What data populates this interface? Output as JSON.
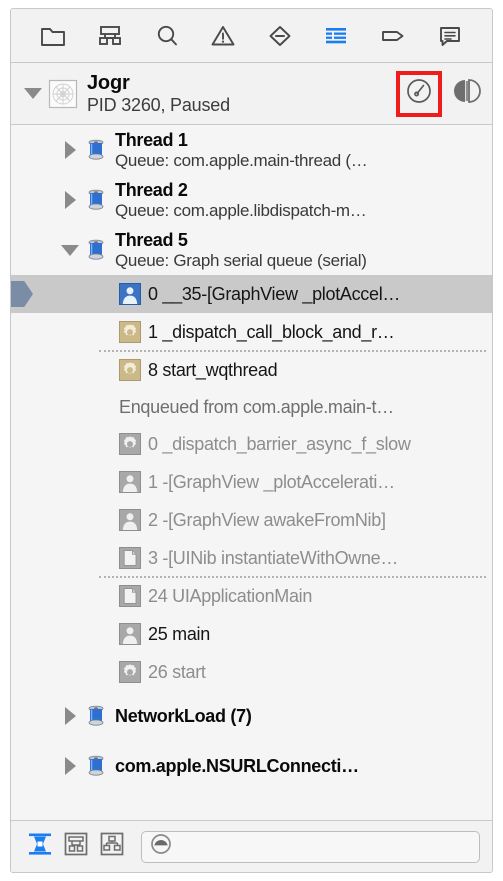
{
  "window": {
    "title": "Debug Navigator"
  },
  "colors": {
    "accent_blue": "#1a7df0",
    "icon_gray": "#4a4a4a",
    "highlight_red": "#ef1c1c",
    "selected_row": "#c9c9c9",
    "pc_marker": "#7a8ca6",
    "panel_bg": "#f5f5f5",
    "toolbar_bg": "#f2f2f2"
  },
  "top_toolbar": {
    "buttons": [
      {
        "icon": "folder-icon",
        "label": "Show the Project navigator",
        "active": false
      },
      {
        "icon": "hierarchy-icon",
        "label": "Show the Symbol navigator",
        "active": false
      },
      {
        "icon": "search-icon",
        "label": "Show the Find navigator",
        "active": false
      },
      {
        "icon": "warning-triangle-icon",
        "label": "Show the Issue navigator",
        "active": false
      },
      {
        "icon": "test-diamond-icon",
        "label": "Show the Test navigator",
        "active": false
      },
      {
        "icon": "debug-list-icon",
        "label": "Show the Debug navigator",
        "active": true
      },
      {
        "icon": "tag-icon",
        "label": "Show the Breakpoint navigator",
        "active": false
      },
      {
        "icon": "speech-bubble-icon",
        "label": "Show the Report navigator",
        "active": false
      }
    ]
  },
  "process_header": {
    "disclosure": "expanded",
    "app_icon": "app-icon",
    "name": "Jogr",
    "subtitle": "PID 3260, Paused",
    "actions": [
      {
        "icon": "gauge-icon",
        "label": "Show process gauges",
        "highlighted": true
      },
      {
        "icon": "view-split-icon",
        "label": "Toggle view",
        "highlighted": false
      }
    ]
  },
  "list": {
    "rows": [
      {
        "kind": "thread",
        "disclosure": "collapsed",
        "icon": "thread-spool-icon",
        "title": "Thread 1",
        "queue": "Queue: com.apple.main-thread (…"
      },
      {
        "kind": "thread",
        "disclosure": "collapsed",
        "icon": "thread-spool-icon",
        "title": "Thread 2",
        "queue": "Queue: com.apple.libdispatch-m…"
      },
      {
        "kind": "thread",
        "disclosure": "expanded",
        "icon": "thread-spool-icon",
        "title": "Thread 5",
        "queue": "Queue: Graph serial queue (serial)"
      },
      {
        "kind": "frame",
        "icon": "user-frame-icon-blue",
        "label": "0 __35-[GraphView _plotAccel…",
        "selected": true,
        "dim": false,
        "pc_marker": true,
        "separator": false
      },
      {
        "kind": "frame",
        "icon": "gear-frame-icon-tan",
        "label": "1 _dispatch_call_block_and_r…",
        "selected": false,
        "dim": false,
        "pc_marker": false,
        "separator": false
      },
      {
        "kind": "frame",
        "icon": "gear-frame-icon-tan",
        "label": "8 start_wqthread",
        "selected": false,
        "dim": false,
        "pc_marker": false,
        "separator": true
      },
      {
        "kind": "note",
        "label": "Enqueued from com.apple.main-t…"
      },
      {
        "kind": "frame",
        "icon": "gear-frame-icon-gray",
        "label": "0 _dispatch_barrier_async_f_slow",
        "selected": false,
        "dim": true,
        "pc_marker": false,
        "separator": false
      },
      {
        "kind": "frame",
        "icon": "user-frame-icon-gray",
        "label": "1 -[GraphView _plotAccelerati…",
        "selected": false,
        "dim": true,
        "pc_marker": false,
        "separator": false
      },
      {
        "kind": "frame",
        "icon": "user-frame-icon-gray",
        "label": "2 -[GraphView awakeFromNib]",
        "selected": false,
        "dim": true,
        "pc_marker": false,
        "separator": false
      },
      {
        "kind": "frame",
        "icon": "doc-frame-icon-gray",
        "label": "3 -[UINib instantiateWithOwne…",
        "selected": false,
        "dim": true,
        "pc_marker": false,
        "separator": false
      },
      {
        "kind": "frame",
        "icon": "doc-frame-icon-gray",
        "label": "24 UIApplicationMain",
        "selected": false,
        "dim": true,
        "pc_marker": false,
        "separator": true
      },
      {
        "kind": "frame",
        "icon": "user-frame-icon-gray",
        "label": "25 main",
        "selected": false,
        "dim": false,
        "pc_marker": false,
        "separator": false
      },
      {
        "kind": "frame",
        "icon": "gear-frame-icon-gray",
        "label": "26 start",
        "selected": false,
        "dim": true,
        "pc_marker": false,
        "separator": false
      },
      {
        "kind": "thread",
        "disclosure": "collapsed",
        "icon": "thread-spool-icon",
        "title": "NetworkLoad (7)",
        "queue": ""
      },
      {
        "kind": "thread",
        "disclosure": "collapsed",
        "icon": "thread-spool-icon",
        "title": "com.apple.NSURLConnecti…",
        "queue": ""
      }
    ]
  },
  "bottom_bar": {
    "scope_buttons": [
      {
        "icon": "view-process-icon",
        "label": "Show only stack frames with debug symbols",
        "active": true
      },
      {
        "icon": "view-threads-icon",
        "label": "Show all threads",
        "active": false
      },
      {
        "icon": "view-queues-icon",
        "label": "Show queues",
        "active": false
      }
    ],
    "filter": {
      "icon": "detail-level-icon",
      "value": "",
      "placeholder": ""
    }
  }
}
